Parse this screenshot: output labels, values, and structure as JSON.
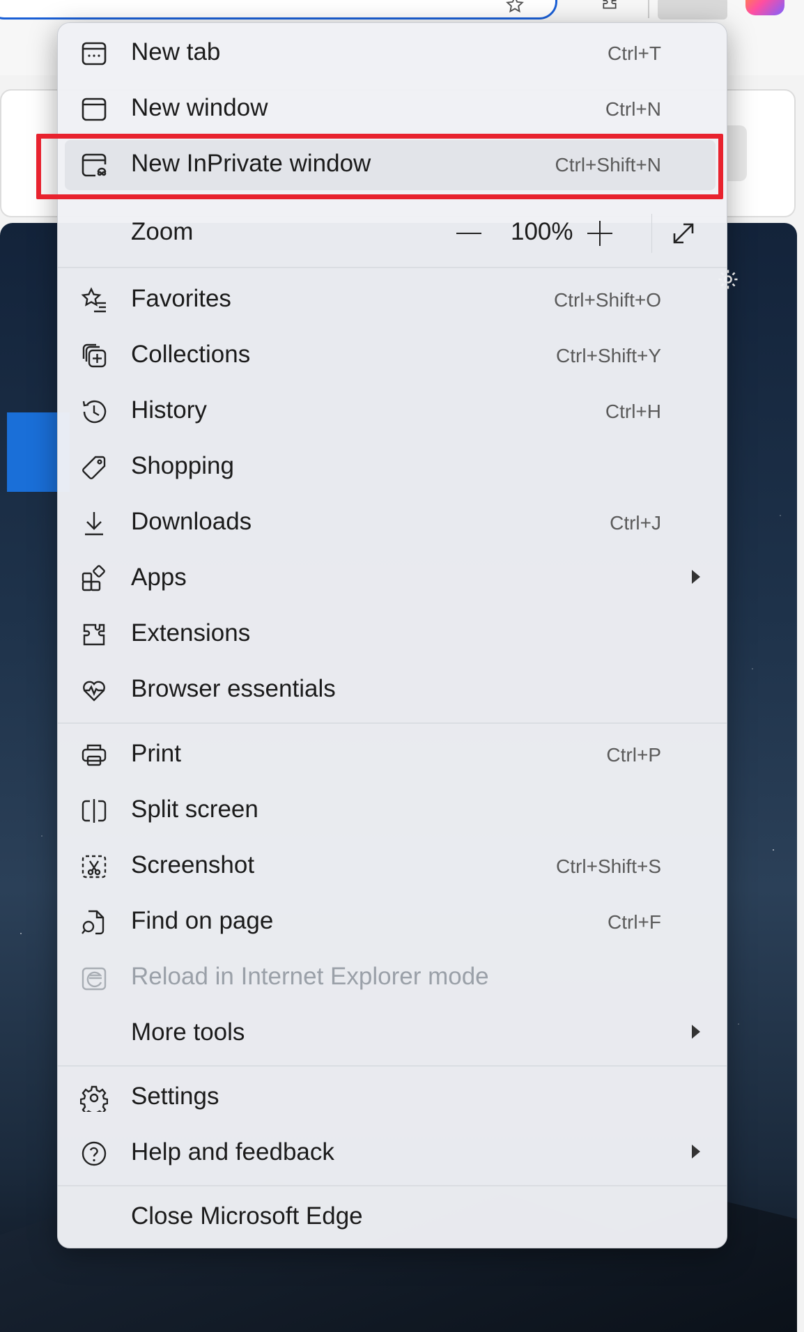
{
  "menu": {
    "new_tab": {
      "label": "New tab",
      "shortcut": "Ctrl+T"
    },
    "new_window": {
      "label": "New window",
      "shortcut": "Ctrl+N"
    },
    "new_inprivate": {
      "label": "New InPrivate window",
      "shortcut": "Ctrl+Shift+N"
    },
    "zoom": {
      "label": "Zoom",
      "value": "100%"
    },
    "favorites": {
      "label": "Favorites",
      "shortcut": "Ctrl+Shift+O"
    },
    "collections": {
      "label": "Collections",
      "shortcut": "Ctrl+Shift+Y"
    },
    "history": {
      "label": "History",
      "shortcut": "Ctrl+H"
    },
    "shopping": {
      "label": "Shopping"
    },
    "downloads": {
      "label": "Downloads",
      "shortcut": "Ctrl+J"
    },
    "apps": {
      "label": "Apps"
    },
    "extensions": {
      "label": "Extensions"
    },
    "browser_essentials": {
      "label": "Browser essentials"
    },
    "print": {
      "label": "Print",
      "shortcut": "Ctrl+P"
    },
    "split_screen": {
      "label": "Split screen"
    },
    "screenshot": {
      "label": "Screenshot",
      "shortcut": "Ctrl+Shift+S"
    },
    "find_on_page": {
      "label": "Find on page",
      "shortcut": "Ctrl+F"
    },
    "reload_ie": {
      "label": "Reload in Internet Explorer mode"
    },
    "more_tools": {
      "label": "More tools"
    },
    "settings": {
      "label": "Settings"
    },
    "help": {
      "label": "Help and feedback"
    },
    "close_edge": {
      "label": "Close Microsoft Edge"
    }
  },
  "colors": {
    "highlight": "#e8222e",
    "accent": "#1a5fd6",
    "menu_bg": "#eff1f5"
  }
}
